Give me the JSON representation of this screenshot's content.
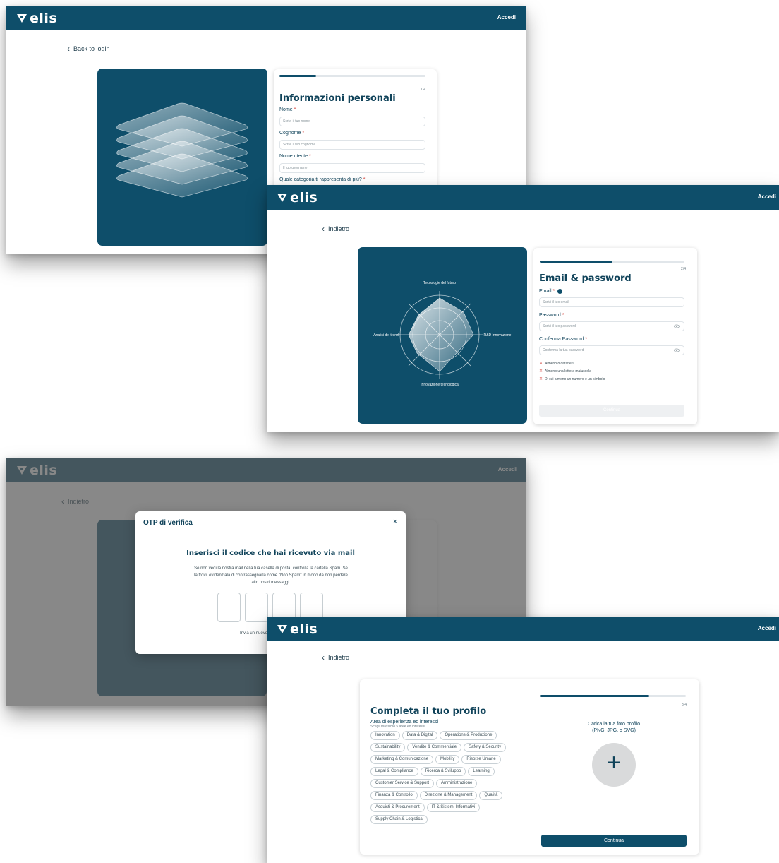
{
  "brand": {
    "name": "elis",
    "accent": "#0e4e6a",
    "error": "#d0342c"
  },
  "topbar": {
    "login_label": "Accedi"
  },
  "screen1": {
    "back_label": "Back to login",
    "step": "1/4",
    "progress": 0.25,
    "title": "Informazioni personali",
    "fields": [
      {
        "label": "Nome",
        "required": "*",
        "placeholder": "Scrivi il tuo nome"
      },
      {
        "label": "Cognome",
        "required": "*",
        "placeholder": "Scrivi il tuo cognome"
      },
      {
        "label": "Nome utente",
        "required": "*",
        "placeholder": "Il tuo username"
      }
    ],
    "question": "Quale categoria ti rappresenta di più?",
    "question_required": "*"
  },
  "screen2": {
    "back_label": "Indietro",
    "step": "2/4",
    "progress": 0.5,
    "title": "Email & password",
    "email_label": "Email",
    "email_info_icon": "info-icon",
    "email_placeholder": "Scrivi il tuo email",
    "password_label": "Password",
    "password_placeholder": "Scrivi il tuo password",
    "confirm_label": "Conferma Password",
    "confirm_placeholder": "Conferma la tua password",
    "required": "*",
    "rules": [
      "Almeno 8 caratteri",
      "Almeno una lettera maiuscola",
      "Di cui almeno un numero e un simbolo"
    ],
    "continue_label": "Continua",
    "radar_labels": [
      "Tecnologie del futuro",
      "R&D Innovazione",
      "Innovazione tecnologica",
      "Analisi dei trend"
    ]
  },
  "screen3": {
    "modal_title": "OTP di verifica",
    "close_icon": "close-icon",
    "heading": "Inserisci il codice che hai ricevuto via mail",
    "text": "Se non vedi la nostra mail nella tua casella di posta, controlla la cartella Spam. Se la trovi, evidenziala di contrassegnarla come \"Non Spam\" in modo da non perdere altri nostri messaggi.",
    "resend_label": "Invia un nuovo codice",
    "code_length": 4
  },
  "screen4": {
    "back_label": "Indietro",
    "step": "3/4",
    "progress": 0.75,
    "title": "Completa il tuo profilo",
    "interests_label": "Area di esperienza ed interessi",
    "interests_hint": "Scegli massimo 5 aree ed interessi",
    "chips": [
      "Innovation",
      "Data & Digital",
      "Operations & Produzione",
      "Sustainability",
      "Vendite & Commerciale",
      "Safety & Security",
      "Marketing & Comunicazione",
      "Mobility",
      "Risorse Umane",
      "Legal & Compliance",
      "Ricerca & Sviluppo",
      "Learning",
      "Customer Service & Support",
      "Amministrazione",
      "Finanza & Controllo",
      "Direzione & Management",
      "Qualità",
      "Acquisti & Procurement",
      "IT & Sistemi Informativi",
      "Supply Chain & Logistica"
    ],
    "upload_label": "Carica la tua foto profilo",
    "upload_formats": "(PNG, JPG, o SVG)",
    "upload_icon": "plus-icon",
    "continue_label": "Continua"
  }
}
